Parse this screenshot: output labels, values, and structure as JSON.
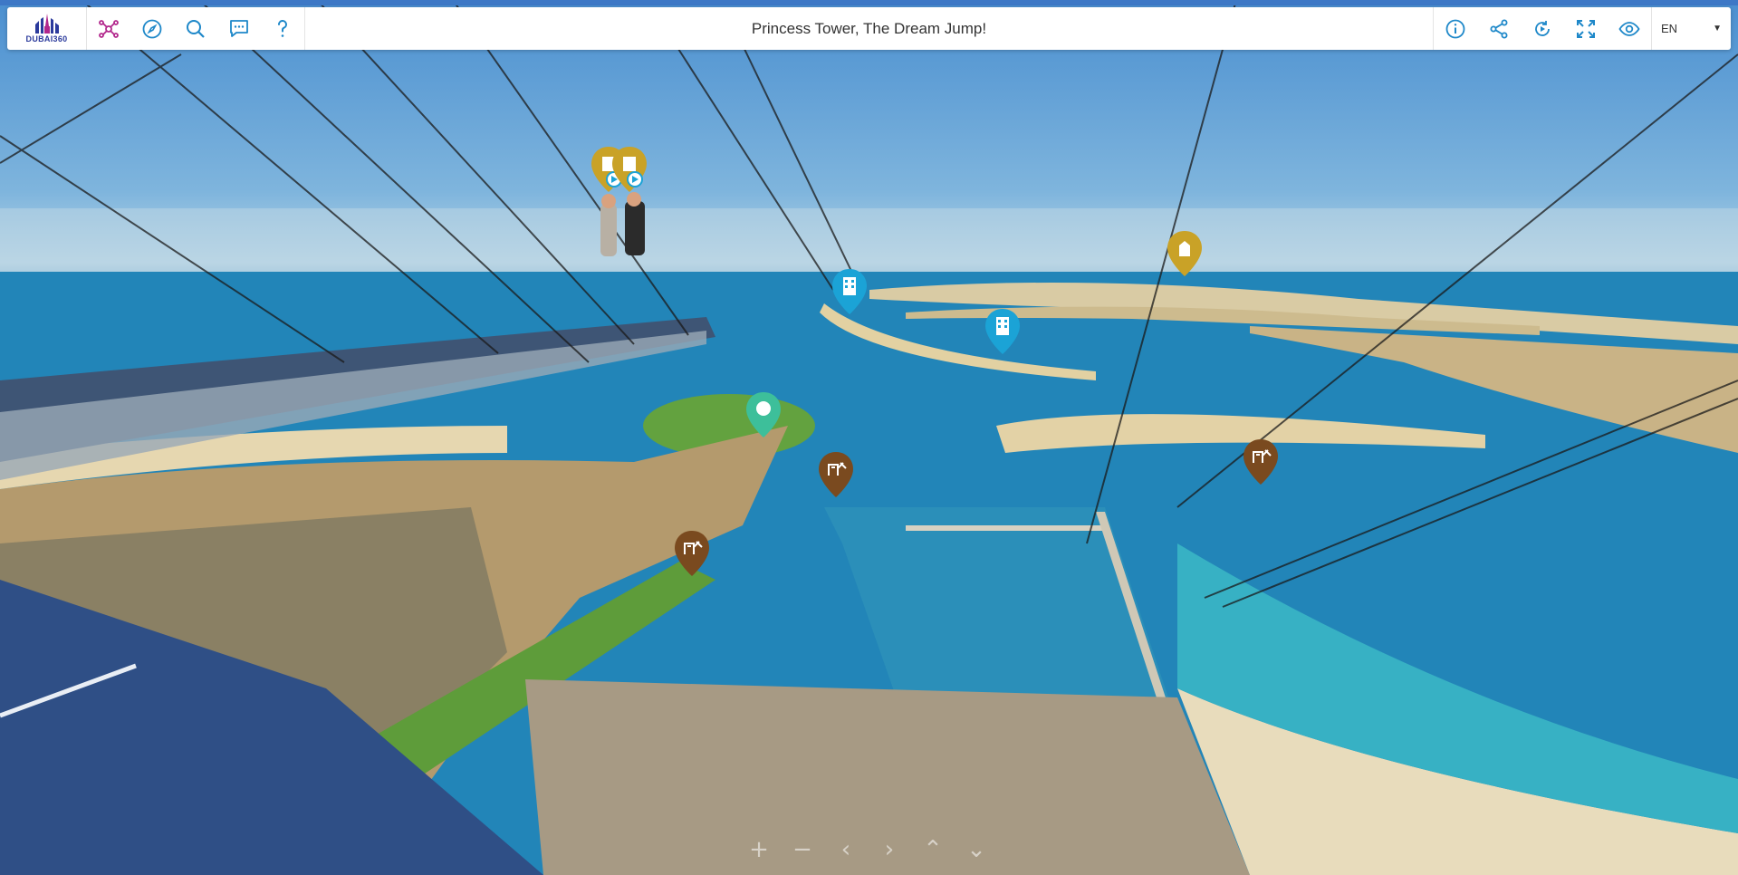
{
  "window": {
    "title": "Princess Tower, The Dream Jump!"
  },
  "logo": {
    "text": "DUBAI360"
  },
  "toolbar_left": [
    {
      "name": "tour-map-button",
      "icon": "network-icon"
    },
    {
      "name": "compass-button",
      "icon": "compass-icon"
    },
    {
      "name": "search-button",
      "icon": "search-icon"
    },
    {
      "name": "comments-button",
      "icon": "chat-icon"
    },
    {
      "name": "help-button",
      "icon": "question-icon"
    }
  ],
  "toolbar_right": [
    {
      "name": "info-button",
      "icon": "info-icon"
    },
    {
      "name": "share-button",
      "icon": "share-icon"
    },
    {
      "name": "autorotate-button",
      "icon": "rotate-icon"
    },
    {
      "name": "fullscreen-button",
      "icon": "fullscreen-icon"
    },
    {
      "name": "view-button",
      "icon": "eye-icon"
    }
  ],
  "language": {
    "selected": "EN"
  },
  "colors": {
    "accent": "#1e88c9",
    "magenta": "#b2278c",
    "pin_gold": "#c9a227",
    "pin_blue": "#1ba3d6",
    "pin_green": "#3dbf9a",
    "pin_brown": "#7a4a1f"
  },
  "hotspots": [
    {
      "kind": "building-gold-video"
    },
    {
      "kind": "building-gold-video"
    },
    {
      "kind": "building-gold"
    },
    {
      "kind": "hotel-blue"
    },
    {
      "kind": "hotel-blue"
    },
    {
      "kind": "golf-green"
    },
    {
      "kind": "transport-brown"
    },
    {
      "kind": "transport-brown"
    },
    {
      "kind": "transport-brown"
    }
  ],
  "nav": [
    "+",
    "−",
    "‹",
    "›",
    "⌃",
    "⌄"
  ]
}
